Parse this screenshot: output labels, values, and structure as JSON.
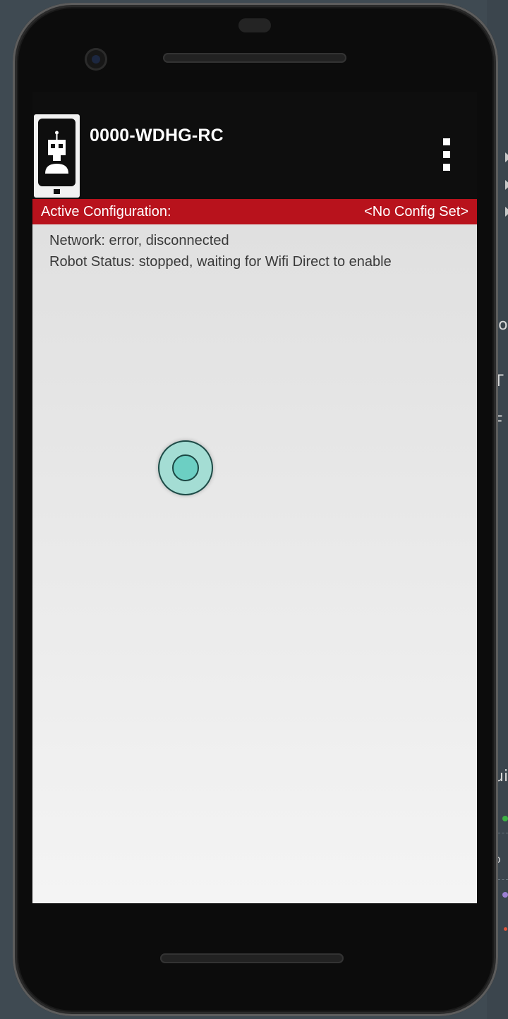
{
  "app": {
    "title": "0000-WDHG-RC",
    "menu_icon": "overflow-menu-icon",
    "logo_icon": "robot-phone-icon"
  },
  "config": {
    "label": "Active Configuration:",
    "value": "<No Config Set>"
  },
  "status": {
    "network": "Network: error, disconnected",
    "robot": "Robot Status: stopped, waiting for Wifi Direct to enable"
  },
  "ide_fragments": [
    "lo",
    "T",
    "F",
    "ui",
    "o"
  ],
  "colors": {
    "config_bar": "#b8121c",
    "touch_fill": "#6ccfc3",
    "touch_ring": "#a4ddd4"
  }
}
